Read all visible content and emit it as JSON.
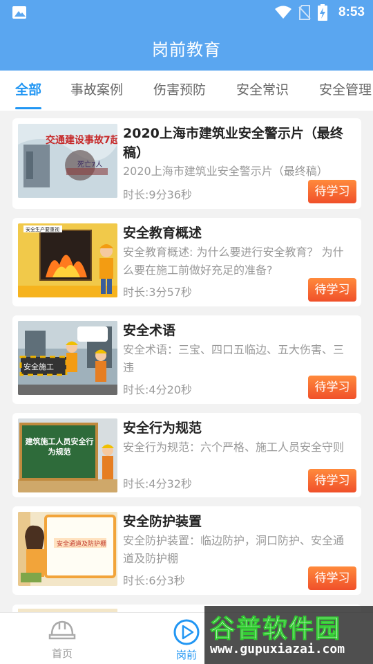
{
  "status_bar": {
    "time": "8:53"
  },
  "header": {
    "title": "岗前教育"
  },
  "tabs": [
    "全部",
    "事故案例",
    "伤害预防",
    "安全常识",
    "安全管理"
  ],
  "courses": [
    {
      "title": "2020上海市建筑业安全警示片（最终稿）",
      "desc": "2020上海市建筑业安全警示片（最终稿）",
      "duration": "时长:9分36秒",
      "button": "待学习",
      "thumb_text": "交通建设事故7起",
      "thumb_text2": "死亡7人"
    },
    {
      "title": "安全教育概述",
      "desc": "安全教育概述: 为什么要进行安全教育？ 为什么要在施工前做好充足的准备?",
      "duration": "时长:3分57秒",
      "button": "待学习",
      "thumb_text": "安全生产要重视"
    },
    {
      "title": "安全术语",
      "desc": "安全术语：三宝、四口五临边、五大伤害、三违",
      "duration": "时长:4分20秒",
      "button": "待学习",
      "thumb_text": "安全施工"
    },
    {
      "title": "安全行为规范",
      "desc": "安全行为规范：六个严格、施工人员安全守则",
      "duration": "时长:4分32秒",
      "button": "待学习",
      "thumb_text": "建筑施工人员安全行为规范"
    },
    {
      "title": "安全防护装置",
      "desc": "安全防护装置：临边防护，洞口防护、安全通道及防护棚",
      "duration": "时长:6分3秒",
      "button": "待学习",
      "thumb_text": "安全通道及防护棚"
    }
  ],
  "bottom_nav": {
    "home": "首页",
    "gangqian": "岗前"
  },
  "watermark": {
    "brand": "谷普软件园",
    "url": "www.gupuxiazai.com"
  },
  "colors": {
    "primary": "#5aa6f0",
    "accent": "#2196f3",
    "button": "#f0502a"
  }
}
